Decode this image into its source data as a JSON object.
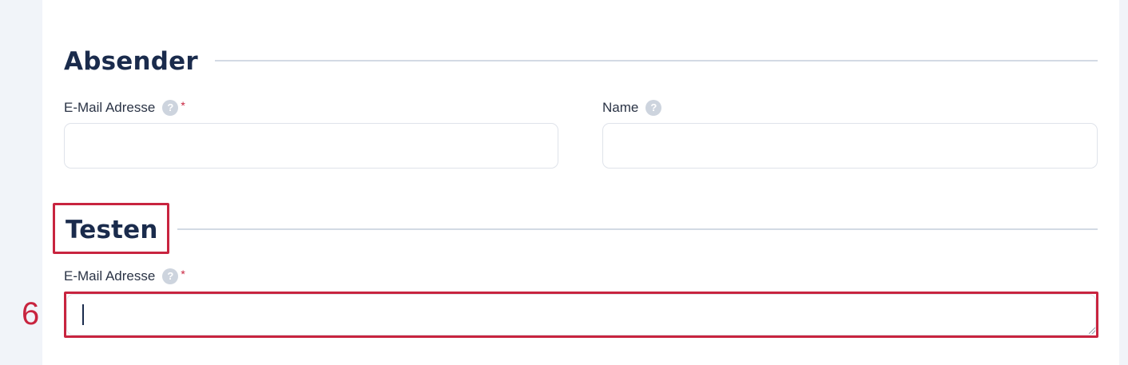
{
  "sender_section": {
    "title": "Absender",
    "email_label": "E-Mail Adresse",
    "email_required_mark": "*",
    "email_value": "",
    "name_label": "Name",
    "name_value": "",
    "help_glyph": "?"
  },
  "test_section": {
    "title": "Testen",
    "email_label": "E-Mail Adresse",
    "email_required_mark": "*",
    "email_value": "",
    "help_glyph": "?"
  },
  "annotation": {
    "step_number": "6"
  },
  "colors": {
    "title": "#1a2b4c",
    "highlight": "#c8243f",
    "help_icon": "#cdd4de",
    "background": "#f1f4f9"
  },
  "icons": {
    "help": "question-circle-icon"
  }
}
